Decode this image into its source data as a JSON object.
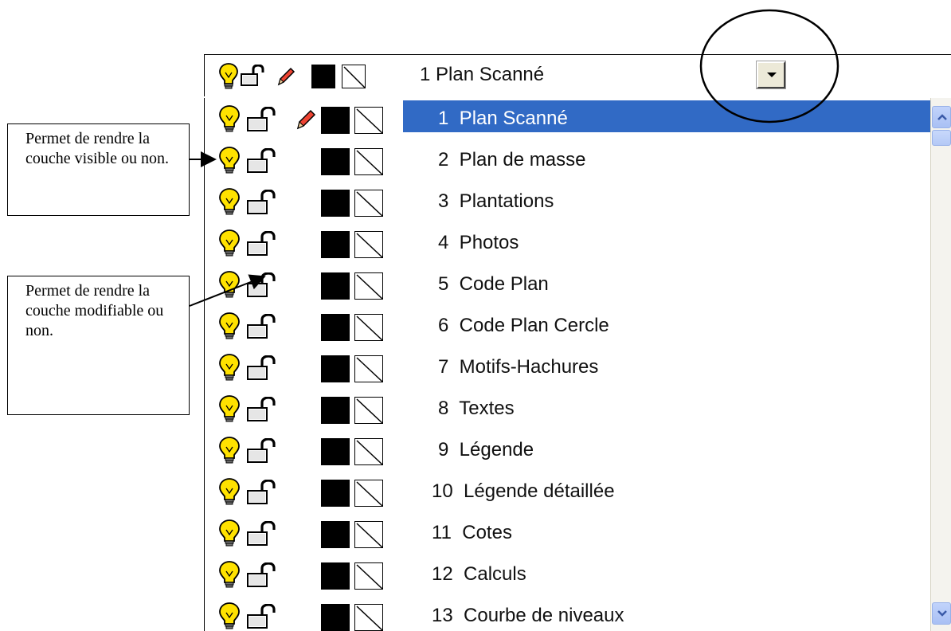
{
  "combo": {
    "selected": "1  Plan Scanné"
  },
  "callouts": {
    "visible_text": "Permet de rendre la couche visible ou non.",
    "editable_text": "Permet de rendre la couche modifiable ou non."
  },
  "layers": [
    {
      "label": "1  Plan Scanné",
      "selected": true,
      "editable_pencil": true
    },
    {
      "label": "2  Plan de masse"
    },
    {
      "label": "3  Plantations"
    },
    {
      "label": "4  Photos"
    },
    {
      "label": "5  Code Plan"
    },
    {
      "label": "6  Code Plan Cercle"
    },
    {
      "label": "7  Motifs-Hachures"
    },
    {
      "label": "8  Textes"
    },
    {
      "label": "9  Légende"
    },
    {
      "label": "10  Légende détaillée"
    },
    {
      "label": "11  Cotes"
    },
    {
      "label": "12  Calculs"
    },
    {
      "label": "13  Courbe de niveaux"
    }
  ],
  "colors": {
    "selection": "#316ac5",
    "bulb": "#ffe200",
    "swatch": "#000000"
  },
  "icons": [
    "lightbulb-icon",
    "unlocked-padlock-icon",
    "pencil-icon",
    "color-swatch-icon",
    "line-style-icon",
    "dropdown-arrow-icon"
  ]
}
